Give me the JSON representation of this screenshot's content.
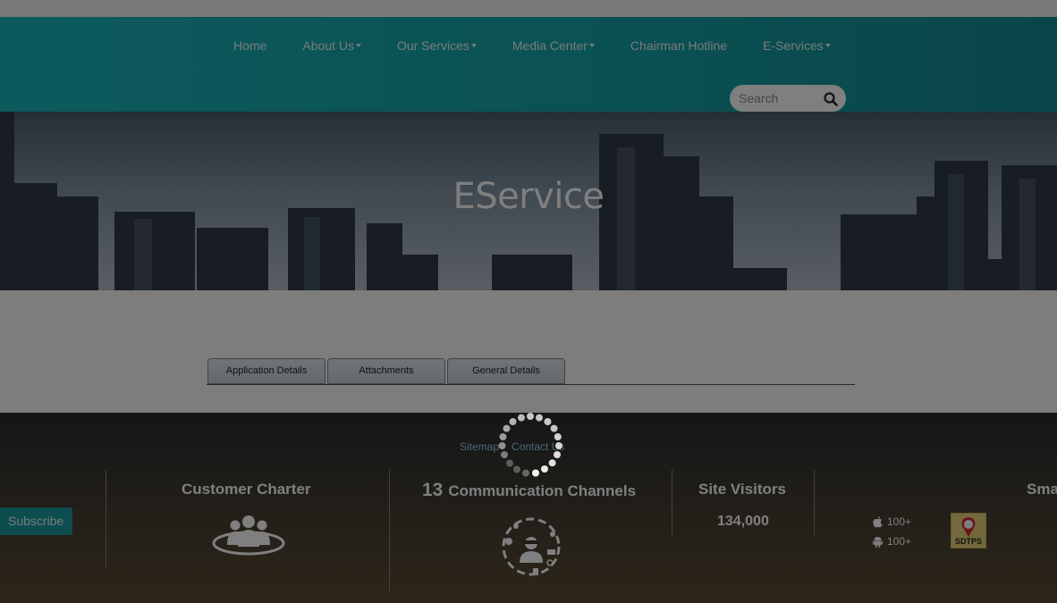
{
  "nav": {
    "items": [
      {
        "label": "Home",
        "dropdown": false
      },
      {
        "label": "About Us",
        "dropdown": true
      },
      {
        "label": "Our Services",
        "dropdown": true
      },
      {
        "label": "Media Center",
        "dropdown": true
      },
      {
        "label": "Chairman Hotline",
        "dropdown": false
      },
      {
        "label": "E-Services",
        "dropdown": true
      }
    ],
    "search_placeholder": "Search"
  },
  "hero": {
    "title": "EService"
  },
  "tabs": [
    "Application Details",
    "Attachments",
    "General Details"
  ],
  "footer": {
    "links": [
      "Sitemap",
      "Contact Us"
    ],
    "subscribe_label": "Subscribe",
    "customer_charter": "Customer Charter",
    "communication_count": "13",
    "communication_channels": "Communication Channels",
    "site_visitors_title": "Site Visitors",
    "site_visitors_count": "134,000",
    "ios_count": "100+",
    "android_count": "100+",
    "sdtps_label": "SDTPS",
    "smart_title": "Sma"
  },
  "state": {
    "loading_overlay": true
  },
  "colors": {
    "navbar": "#19b5b9",
    "footer": "#3b382f",
    "accent": "#1a9a9f"
  }
}
